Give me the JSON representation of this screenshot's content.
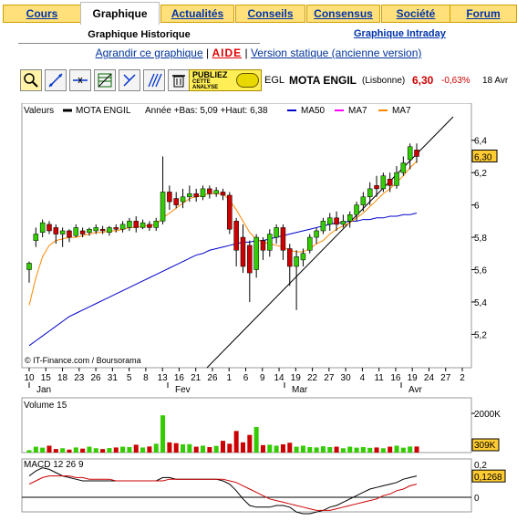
{
  "tabs": [
    {
      "label": "Cours",
      "active": false
    },
    {
      "label": "Graphique",
      "active": true
    },
    {
      "label": "Actualités",
      "active": false
    },
    {
      "label": "Conseils",
      "active": false
    },
    {
      "label": "Consensus",
      "active": false
    },
    {
      "label": "Société",
      "active": false
    },
    {
      "label": "Forum",
      "active": false
    }
  ],
  "subnav": {
    "historique": "Graphique Historique",
    "intraday": "Graphique Intraday"
  },
  "links": {
    "agrandir": "Agrandir ce graphique",
    "sep1": "|",
    "aide": "AIDE",
    "sep2": "|",
    "version": "Version statique (ancienne version)"
  },
  "toolbar": {
    "tools": [
      "zoom-icon",
      "trendline-icon",
      "hline-icon",
      "fibonacci-icon",
      "arrows-icon",
      "multi-line-icon",
      "trash-icon"
    ],
    "publiez": {
      "line1": "PUBLIEZ",
      "line2": "CETTE",
      "line3": "ANALYSE"
    }
  },
  "quote": {
    "ticker": "EGL",
    "name": "MOTA ENGIL",
    "market": "(Lisbonne)",
    "price": "6,30",
    "change": "-0,63%",
    "date": "18 Avr",
    "price_color": "#cc0000"
  },
  "legend": {
    "valeurs": "Valeurs",
    "name": "MOTA ENGIL",
    "range": "Année +Bas: 5,09 +Haut: 6,38",
    "ma50": "MA50",
    "ma7a": "MA7",
    "ma7b": "MA7"
  },
  "colors": {
    "up": "#33cc00",
    "down": "#cc0000",
    "ma50": "#0000cc",
    "ma7": "#ff8800",
    "ma7b": "#ff00ff",
    "current_bg": "#ffcc33",
    "macd": "#000000",
    "signal": "#cc0000"
  },
  "credit": "© IT-Finance.com / Boursorama",
  "x_ticks": [
    "10",
    "15",
    "18",
    "23",
    "26",
    "31",
    "5",
    "8",
    "13",
    "16",
    "21",
    "26",
    "1",
    "6",
    "9",
    "14",
    "19",
    "22",
    "27",
    "30",
    "4",
    "11",
    "16",
    "19",
    "24",
    "27",
    "2"
  ],
  "months": [
    "Jan",
    "Fev",
    "Mar",
    "Avr"
  ],
  "price_ticks": [
    "6,4",
    "6,2",
    "6",
    "5,8",
    "5,6",
    "5,4",
    "5,2"
  ],
  "current_price_label": "6,30",
  "volume": {
    "title": "Volume 15",
    "tick": "2000K",
    "current": "309K"
  },
  "macd": {
    "title": "MACD 12 26 9",
    "tick_top": "0,2",
    "tick_zero": "0",
    "current": "0,1268"
  },
  "chart_data": {
    "type": "candlestick",
    "ylim": [
      5.05,
      6.5
    ],
    "candles": [
      [
        5.6,
        5.64,
        5.52,
        5.65
      ],
      [
        5.78,
        5.82,
        5.74,
        5.86
      ],
      [
        5.83,
        5.89,
        5.8,
        5.91
      ],
      [
        5.88,
        5.84,
        5.82,
        5.9
      ],
      [
        5.86,
        5.82,
        5.76,
        5.88
      ],
      [
        5.82,
        5.84,
        5.74,
        5.86
      ],
      [
        5.84,
        5.8,
        5.77,
        5.85
      ],
      [
        5.81,
        5.86,
        5.8,
        5.88
      ],
      [
        5.84,
        5.82,
        5.8,
        5.86
      ],
      [
        5.83,
        5.85,
        5.81,
        5.86
      ],
      [
        5.84,
        5.86,
        5.82,
        5.88
      ],
      [
        5.85,
        5.84,
        5.82,
        5.87
      ],
      [
        5.83,
        5.86,
        5.81,
        5.87
      ],
      [
        5.86,
        5.85,
        5.83,
        5.88
      ],
      [
        5.85,
        5.88,
        5.83,
        5.9
      ],
      [
        5.86,
        5.9,
        5.84,
        5.92
      ],
      [
        5.9,
        5.86,
        5.83,
        5.93
      ],
      [
        5.86,
        5.89,
        5.85,
        5.91
      ],
      [
        5.88,
        5.86,
        5.84,
        5.9
      ],
      [
        5.86,
        5.9,
        5.84,
        5.92
      ],
      [
        5.9,
        6.08,
        5.88,
        6.3
      ],
      [
        6.08,
        6.02,
        5.97,
        6.12
      ],
      [
        6.04,
        6.0,
        5.98,
        6.08
      ],
      [
        6.02,
        6.05,
        5.98,
        6.1
      ],
      [
        6.05,
        6.07,
        6.02,
        6.12
      ],
      [
        6.07,
        6.05,
        6.02,
        6.1
      ],
      [
        6.05,
        6.1,
        6.03,
        6.12
      ],
      [
        6.1,
        6.07,
        6.04,
        6.12
      ],
      [
        6.07,
        6.09,
        6.05,
        6.11
      ],
      [
        6.08,
        6.06,
        6.03,
        6.1
      ],
      [
        6.06,
        5.85,
        5.82,
        6.08
      ],
      [
        5.9,
        5.72,
        5.62,
        5.92
      ],
      [
        5.8,
        5.62,
        5.58,
        5.88
      ],
      [
        5.75,
        5.58,
        5.4,
        5.78
      ],
      [
        5.6,
        5.8,
        5.55,
        5.82
      ],
      [
        5.78,
        5.72,
        5.66,
        5.8
      ],
      [
        5.72,
        5.82,
        5.68,
        5.85
      ],
      [
        5.8,
        5.86,
        5.76,
        5.88
      ],
      [
        5.86,
        5.72,
        5.66,
        5.88
      ],
      [
        5.73,
        5.62,
        5.5,
        5.76
      ],
      [
        5.62,
        5.68,
        5.35,
        5.72
      ],
      [
        5.66,
        5.7,
        5.62,
        5.73
      ],
      [
        5.72,
        5.8,
        5.7,
        5.82
      ],
      [
        5.8,
        5.84,
        5.76,
        5.86
      ],
      [
        5.84,
        5.9,
        5.82,
        5.92
      ],
      [
        5.88,
        5.92,
        5.84,
        5.95
      ],
      [
        5.92,
        5.88,
        5.84,
        5.96
      ],
      [
        5.88,
        5.9,
        5.86,
        5.94
      ],
      [
        5.9,
        5.94,
        5.86,
        5.96
      ],
      [
        5.94,
        6.0,
        5.9,
        6.02
      ],
      [
        6.0,
        6.05,
        5.96,
        6.08
      ],
      [
        6.05,
        6.1,
        6.0,
        6.14
      ],
      [
        6.12,
        6.1,
        6.05,
        6.18
      ],
      [
        6.1,
        6.18,
        6.08,
        6.2
      ],
      [
        6.16,
        6.12,
        6.08,
        6.2
      ],
      [
        6.12,
        6.2,
        6.1,
        6.24
      ],
      [
        6.2,
        6.26,
        6.18,
        6.3
      ],
      [
        6.28,
        6.36,
        6.22,
        6.38
      ],
      [
        6.34,
        6.3,
        6.26,
        6.38
      ]
    ],
    "ma7": [
      5.38,
      5.55,
      5.68,
      5.75,
      5.78,
      5.79,
      5.8,
      5.8,
      5.81,
      5.82,
      5.83,
      5.83,
      5.84,
      5.84,
      5.85,
      5.86,
      5.86,
      5.87,
      5.87,
      5.88,
      5.92,
      5.95,
      5.98,
      6.01,
      6.04,
      6.05,
      6.06,
      6.07,
      6.07,
      6.07,
      6.03,
      5.97,
      5.9,
      5.83,
      5.79,
      5.77,
      5.76,
      5.75,
      5.74,
      5.72,
      5.71,
      5.71,
      5.73,
      5.76,
      5.78,
      5.82,
      5.85,
      5.87,
      5.89,
      5.92,
      5.95,
      5.99,
      6.03,
      6.07,
      6.1,
      6.14,
      6.18,
      6.23,
      6.27
    ],
    "ma50": [
      5.13,
      5.16,
      5.19,
      5.22,
      5.25,
      5.28,
      5.31,
      5.33,
      5.35,
      5.37,
      5.39,
      5.41,
      5.43,
      5.45,
      5.47,
      5.49,
      5.51,
      5.53,
      5.55,
      5.57,
      5.59,
      5.61,
      5.63,
      5.65,
      5.67,
      5.69,
      5.7,
      5.72,
      5.73,
      5.74,
      5.75,
      5.76,
      5.77,
      5.77,
      5.78,
      5.78,
      5.79,
      5.8,
      5.81,
      5.82,
      5.83,
      5.84,
      5.85,
      5.86,
      5.87,
      5.88,
      5.89,
      5.89,
      5.9,
      5.9,
      5.91,
      5.91,
      5.92,
      5.92,
      5.93,
      5.93,
      5.94,
      5.94,
      5.95
    ],
    "volume": [
      120,
      300,
      250,
      350,
      180,
      220,
      150,
      260,
      200,
      300,
      220,
      180,
      230,
      260,
      300,
      280,
      400,
      260,
      310,
      450,
      1900,
      520,
      480,
      420,
      430,
      300,
      350,
      280,
      340,
      600,
      450,
      1100,
      520,
      900,
      1300,
      380,
      400,
      350,
      420,
      500,
      300,
      350,
      280,
      260,
      320,
      280,
      300,
      220,
      300,
      250,
      280,
      240,
      260,
      220,
      300,
      350,
      250,
      310,
      309
    ],
    "macd": [
      0.13,
      0.16,
      0.18,
      0.17,
      0.15,
      0.13,
      0.12,
      0.11,
      0.1,
      0.1,
      0.1,
      0.1,
      0.1,
      0.1,
      0.1,
      0.1,
      0.1,
      0.1,
      0.1,
      0.1,
      0.12,
      0.12,
      0.11,
      0.11,
      0.11,
      0.11,
      0.11,
      0.11,
      0.11,
      0.1,
      0.08,
      0.04,
      -0.01,
      -0.05,
      -0.06,
      -0.06,
      -0.06,
      -0.05,
      -0.05,
      -0.06,
      -0.09,
      -0.1,
      -0.1,
      -0.09,
      -0.08,
      -0.06,
      -0.05,
      -0.03,
      -0.01,
      0.01,
      0.03,
      0.05,
      0.06,
      0.07,
      0.08,
      0.09,
      0.11,
      0.12,
      0.13
    ],
    "signal": [
      0.08,
      0.1,
      0.12,
      0.13,
      0.13,
      0.13,
      0.13,
      0.12,
      0.12,
      0.11,
      0.11,
      0.11,
      0.11,
      0.1,
      0.1,
      0.1,
      0.1,
      0.1,
      0.1,
      0.1,
      0.1,
      0.11,
      0.11,
      0.11,
      0.11,
      0.11,
      0.11,
      0.11,
      0.11,
      0.11,
      0.1,
      0.09,
      0.07,
      0.05,
      0.03,
      0.01,
      -0.01,
      -0.02,
      -0.03,
      -0.04,
      -0.05,
      -0.06,
      -0.07,
      -0.08,
      -0.08,
      -0.08,
      -0.07,
      -0.06,
      -0.05,
      -0.04,
      -0.03,
      -0.02,
      -0.01,
      0.01,
      0.02,
      0.04,
      0.05,
      0.07,
      0.08
    ]
  }
}
